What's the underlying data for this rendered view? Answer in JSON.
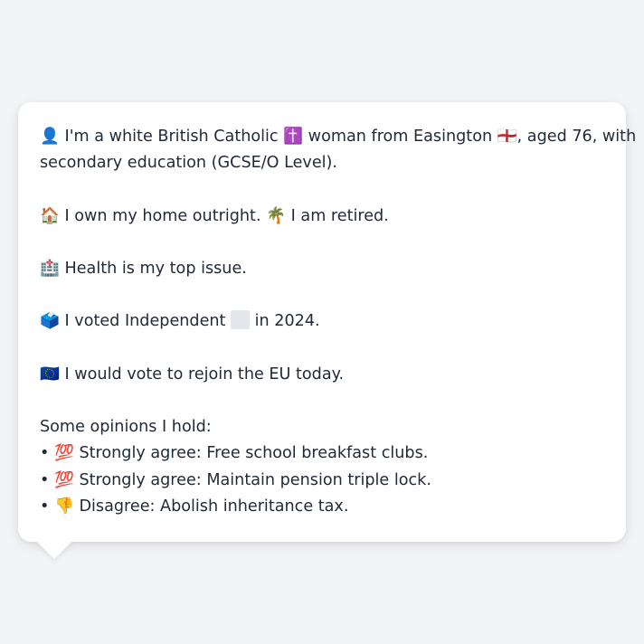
{
  "card": {
    "intro_line_1": "👤 I'm a white British Catholic ✝️ woman from Easington 🏴󠁧󠁢󠁥󠁮󠁧󠁿, aged 76, with",
    "intro_line_2": "secondary education (GCSE/O Level).",
    "home_line": "🏠 I own my home outright. 🌴 I am retired.",
    "issue_line": "🏥 Health is my top issue.",
    "vote_prefix": "🗳️ I voted Independent",
    "vote_suffix": "in 2024.",
    "eu_line": "🇪🇺 I would vote to rejoin the EU today.",
    "opinions_heading": "Some opinions I hold:",
    "opinions": [
      "• 💯 Strongly agree: Free school breakfast clubs.",
      "• 💯 Strongly agree: Maintain pension triple lock.",
      "• 👎 Disagree: Abolish inheritance tax."
    ]
  }
}
